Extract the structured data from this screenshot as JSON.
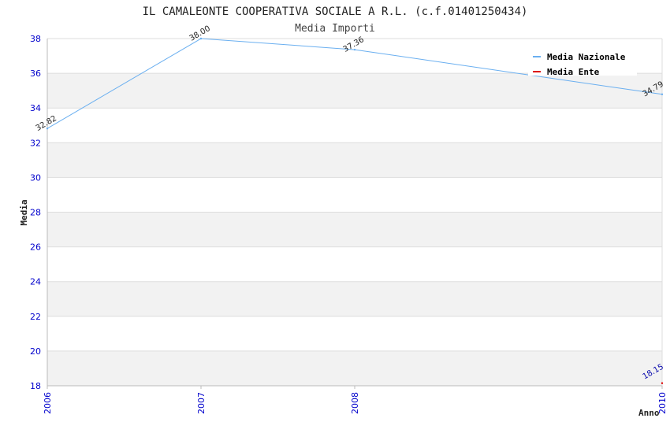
{
  "chart_data": {
    "type": "line",
    "title": "IL CAMALEONTE COOPERATIVA SOCIALE A R.L. (c.f.01401250434)",
    "subtitle": "Media Importi",
    "xlabel": "Anno",
    "ylabel": "Media",
    "x": [
      "2006",
      "2007",
      "2008",
      "2010"
    ],
    "x_range": [
      2006,
      2010
    ],
    "ylim": [
      18,
      38
    ],
    "yticks": [
      "18",
      "20",
      "22",
      "24",
      "26",
      "28",
      "30",
      "32",
      "34",
      "36",
      "38"
    ],
    "grid": true,
    "legend_position": "top-right",
    "series": [
      {
        "name": "Media Nazionale",
        "color": "#6aaff0",
        "points": [
          {
            "x": 2006,
            "y": 32.82,
            "label": "32.82"
          },
          {
            "x": 2007,
            "y": 38.0,
            "label": "38.00"
          },
          {
            "x": 2008,
            "y": 37.36,
            "label": "37.36"
          },
          {
            "x": 2010,
            "y": 34.79,
            "label": "34.79"
          }
        ]
      },
      {
        "name": "Media Ente",
        "color": "#dd0000",
        "points": [
          {
            "x": 2010,
            "y": 18.15,
            "label": "18.15"
          }
        ]
      }
    ],
    "colors": {
      "axis_text": "#0000cc",
      "band": "#f2f2f2",
      "grid": "#dddddd",
      "label_text": "#222222",
      "ente_label_text": "#0000aa"
    }
  }
}
